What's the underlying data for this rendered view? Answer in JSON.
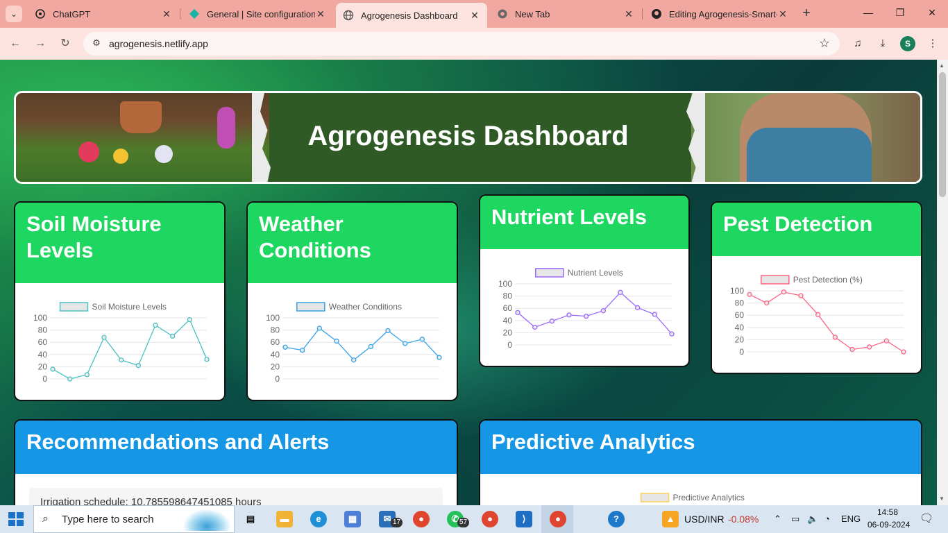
{
  "browser": {
    "tabs": [
      {
        "title": "ChatGPT",
        "favicon": "chatgpt-icon"
      },
      {
        "title": "General | Site configuration |",
        "favicon": "netlify-icon"
      },
      {
        "title": "Agrogenesis Dashboard",
        "favicon": "globe-icon",
        "active": true
      },
      {
        "title": "New Tab",
        "favicon": "chrome-icon"
      },
      {
        "title": "Editing Agrogenesis-Smart-F",
        "favicon": "github-icon"
      }
    ],
    "url": "agrogenesis.netlify.app",
    "profile_initial": "S"
  },
  "page": {
    "title": "Agrogenesis Dashboard",
    "cards": {
      "soil": "Soil Moisture Levels",
      "weather": "Weather Conditions",
      "nutrient": "Nutrient Levels",
      "pest": "Pest Detection",
      "recommendations": "Recommendations and Alerts",
      "predictive": "Predictive Analytics"
    },
    "irrigation_text": "Irrigation schedule: 10.785598647451085 hours"
  },
  "chart_data": [
    {
      "type": "line",
      "id": "soil",
      "legend": "Soil Moisture Levels",
      "color": "#4bc0c0",
      "ylim": [
        0,
        100
      ],
      "yticks": [
        0,
        20,
        40,
        60,
        80,
        100
      ],
      "values": [
        16,
        0,
        7,
        68,
        31,
        22,
        88,
        70,
        97,
        32
      ]
    },
    {
      "type": "line",
      "id": "weather",
      "legend": "Weather Conditions",
      "color": "#36a2eb",
      "ylim": [
        0,
        100
      ],
      "yticks": [
        0,
        20,
        40,
        60,
        80,
        100
      ],
      "values": [
        52,
        47,
        83,
        62,
        31,
        53,
        79,
        58,
        65,
        35
      ]
    },
    {
      "type": "line",
      "id": "nutrient",
      "legend": "Nutrient Levels",
      "color": "#9966ff",
      "ylim": [
        0,
        100
      ],
      "yticks": [
        0,
        20,
        40,
        60,
        80,
        100
      ],
      "values": [
        53,
        29,
        39,
        49,
        47,
        56,
        86,
        61,
        50,
        18
      ]
    },
    {
      "type": "line",
      "id": "pest",
      "legend": "Pest Detection (%)",
      "color": "#ff6384",
      "ylim": [
        0,
        100
      ],
      "yticks": [
        0,
        20,
        40,
        60,
        80,
        100
      ],
      "values": [
        94,
        80,
        98,
        92,
        61,
        24,
        4,
        8,
        18,
        0
      ]
    },
    {
      "type": "line",
      "id": "predictive",
      "legend": "Predictive Analytics",
      "color": "#ffce56",
      "values": []
    }
  ],
  "taskbar": {
    "search_placeholder": "Type here to search",
    "mail_badge": "17",
    "whatsapp_badge": "57",
    "ticker_label": "USD/INR",
    "ticker_value": "-0.08%",
    "lang": "ENG",
    "time": "14:58",
    "date": "06-09-2024"
  }
}
